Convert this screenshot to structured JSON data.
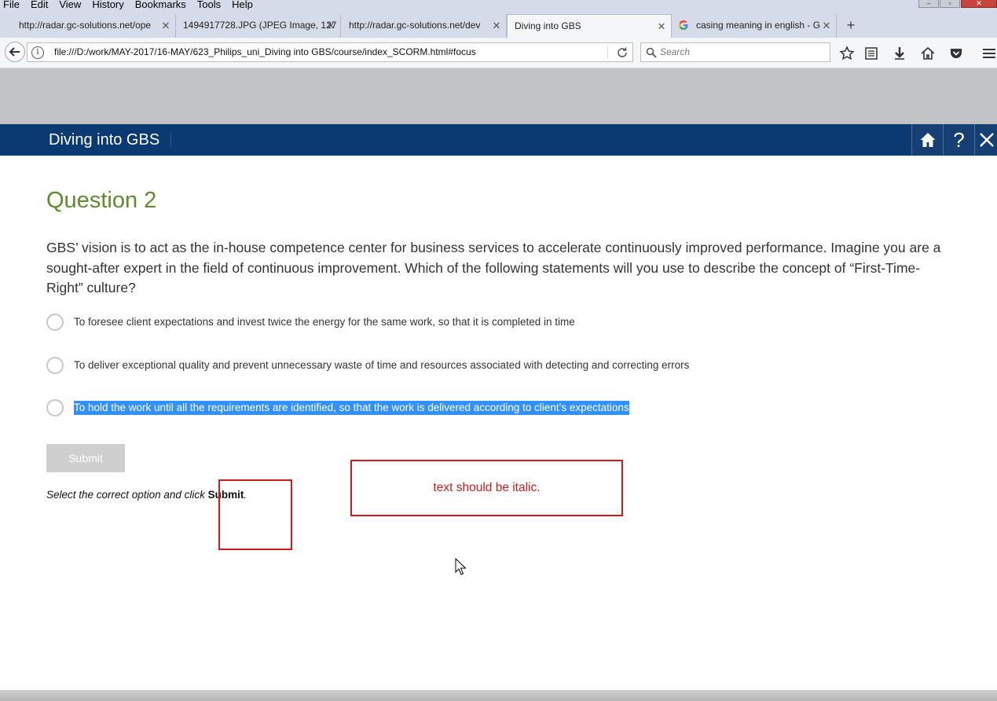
{
  "browser": {
    "menu": [
      "File",
      "Edit",
      "View",
      "History",
      "Bookmarks",
      "Tools",
      "Help"
    ],
    "tabs": [
      {
        "title": "http://radar.gc-solutions.net/ope"
      },
      {
        "title": "1494917728.JPG (JPEG Image, 127"
      },
      {
        "title": "http://radar.gc-solutions.net/dev"
      },
      {
        "title": "Diving into GBS"
      },
      {
        "title": "casing meaning in english - G"
      }
    ],
    "active_tab_index": 3,
    "url": "file:///D:/work/MAY-2017/16-MAY/623_Philips_uni_Diving into GBS/course/index_SCORM.html#focus",
    "search_placeholder": "Search"
  },
  "course": {
    "title": "Diving into GBS",
    "header_bg_color": "#0b3a73",
    "question_title": "Question 2",
    "question_text": "GBS’ vision is to act as the in-house competence center for business services to accelerate continuously improved performance. Imagine you are a sought-after expert in the field of continuous improvement. Which of the following statements will you use to describe the concept of “First-Time-Right” culture?",
    "options": [
      {
        "label": "To foresee client expectations and invest twice the energy for the same work, so that it is completed in time",
        "text_selected": false
      },
      {
        "label": "To deliver exceptional quality and prevent unnecessary waste of time and resources associated with detecting and correcting errors",
        "text_selected": false
      },
      {
        "label": "To hold the work until all the requirements are identified, so that the work is delivered according to client’s expectations",
        "text_selected": true
      }
    ],
    "submit_label": "Submit",
    "instruction_prefix": "Select the correct option and click ",
    "instruction_bold": "Submit",
    "instruction_suffix": "."
  },
  "annotation": {
    "note": "text should be italic.",
    "color": "#cc1b1b"
  }
}
